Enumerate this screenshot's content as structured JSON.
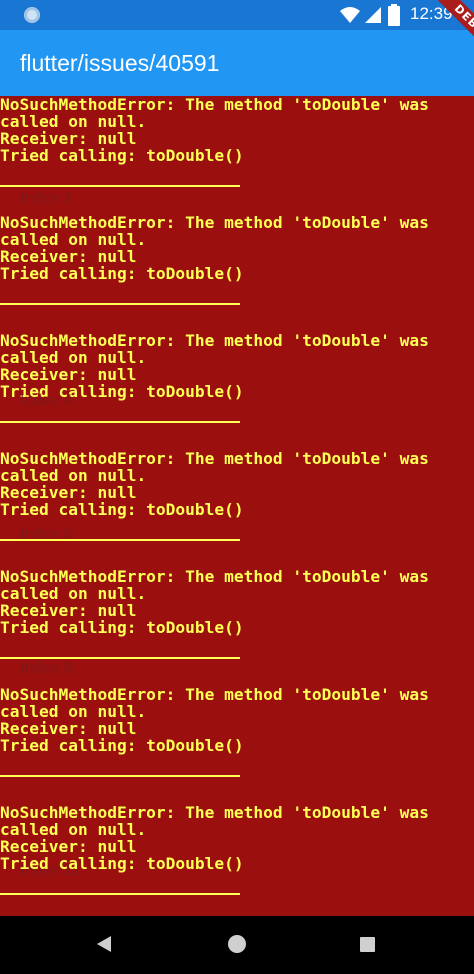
{
  "status_bar": {
    "time": "12:39",
    "icons": [
      "status-dot-icon",
      "wifi-icon",
      "signal-icon",
      "battery-icon"
    ]
  },
  "app_bar": {
    "title": "flutter/issues/40591"
  },
  "debug_banner": {
    "label": "DEBUG"
  },
  "error": {
    "line1": "NoSuchMethodError: The method 'toDouble' was",
    "line2": "called on null.",
    "line3": "Receiver: null",
    "line4": "Tried calling: toDouble()"
  },
  "blocks": [
    {
      "index_label": ""
    },
    {
      "index_label": "Index 1"
    },
    {
      "index_label": ""
    },
    {
      "index_label": "Index 4"
    },
    {
      "index_label": "Index 6"
    },
    {
      "index_label": "Index 8"
    },
    {
      "index_label": "Index 11"
    }
  ],
  "colors": {
    "status_bar": "#1976d2",
    "app_bar": "#2196f3",
    "error_bg": "#9b0f0f",
    "error_text": "#ffff55"
  },
  "nav_bar": {
    "icons": [
      "back-icon",
      "home-icon",
      "recents-icon"
    ]
  }
}
